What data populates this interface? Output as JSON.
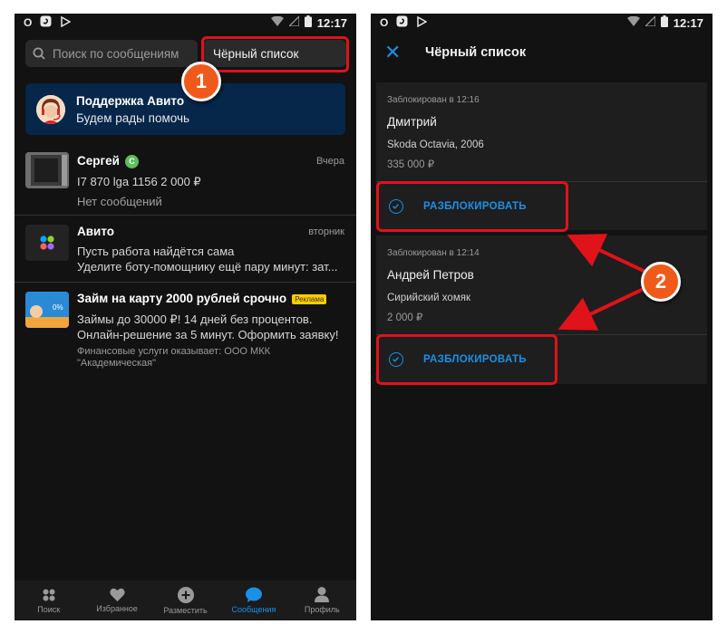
{
  "left_screen": {
    "status_bar": {
      "time": "12:17"
    },
    "search": {
      "placeholder": "Поиск по сообщениям"
    },
    "blacklist_button": "Чёрный список",
    "support": {
      "title": "Поддержка Авито",
      "subtitle": "Будем рады помочь"
    },
    "chats": [
      {
        "name": "Сергей",
        "badge": "С",
        "date": "Вчера",
        "line1": "I7 870 lga 1156  2 000 ₽",
        "line2": "Нет сообщений"
      },
      {
        "name": "Авито",
        "date": "вторник",
        "line1": "Пусть работа найдётся сама",
        "line2": "Уделите боту-помощнику ещё пару минут: зат..."
      },
      {
        "name": "Займ на карту 2000 рублей срочно",
        "ad_label": "Реклама",
        "line1": "Займы до 30000 ₽! 14 дней без процентов.",
        "line2": "Онлайн-решение за 5 минут. Оформить заявку!",
        "line3": "Финансовые услуги оказывает: ООО МКК",
        "line4": "\"Академическая\""
      }
    ],
    "bottom_nav": [
      {
        "label": "Поиск",
        "icon": "search-icon"
      },
      {
        "label": "Избранное",
        "icon": "heart-icon"
      },
      {
        "label": "Разместить",
        "icon": "plus-circle-icon"
      },
      {
        "label": "Сообщения",
        "icon": "chat-bubble-icon",
        "active": true
      },
      {
        "label": "Профиль",
        "icon": "person-icon"
      }
    ]
  },
  "right_screen": {
    "status_bar": {
      "time": "12:17"
    },
    "title": "Чёрный список",
    "blocked": [
      {
        "meta": "Заблокирован в 12:16",
        "name": "Дмитрий",
        "item": "Skoda Octavia, 2006",
        "price": "335 000 ₽",
        "action": "РАЗБЛОКИРОВАТЬ"
      },
      {
        "meta": "Заблокирован в 12:14",
        "name": "Андрей Петров",
        "item": "Сирийский хомяк",
        "price": "2 000 ₽",
        "action": "РАЗБЛОКИРОВАТЬ"
      }
    ]
  },
  "annotations": {
    "step1": "1",
    "step2": "2"
  },
  "colors": {
    "accent": "#1a90e6",
    "highlight": "#e0121a",
    "step_bubble": "#ef5a1a",
    "support_bg": "#06264a"
  }
}
